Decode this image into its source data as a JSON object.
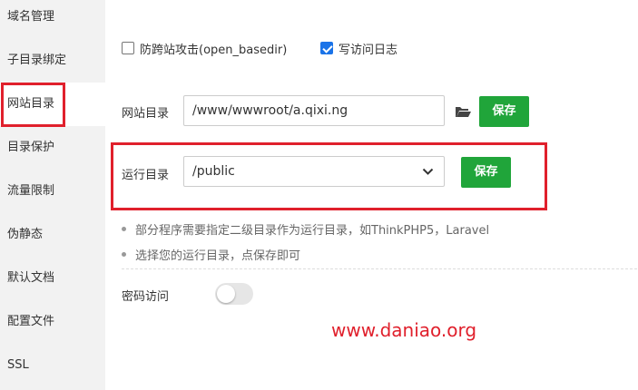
{
  "sidebar": {
    "items": [
      {
        "label": "域名管理"
      },
      {
        "label": "子目录绑定"
      },
      {
        "label": "网站目录"
      },
      {
        "label": "目录保护"
      },
      {
        "label": "流量限制"
      },
      {
        "label": "伪静态"
      },
      {
        "label": "默认文档"
      },
      {
        "label": "配置文件"
      },
      {
        "label": "SSL"
      }
    ]
  },
  "options": {
    "open_basedir_label": "防跨站攻击(open_basedir)",
    "open_basedir_checked": false,
    "access_log_label": "写访问日志",
    "access_log_checked": true
  },
  "site_dir": {
    "label": "网站目录",
    "value": "/www/wwwroot/a.qixi.ng",
    "save_label": "保存",
    "folder_icon": "folder-open-icon"
  },
  "run_dir": {
    "label": "运行目录",
    "selected": "/public",
    "save_label": "保存"
  },
  "notes": [
    "部分程序需要指定二级目录作为运行目录，如ThinkPHP5，Laravel",
    "选择您的运行目录，点保存即可"
  ],
  "password_access": {
    "label": "密码访问",
    "enabled": false
  },
  "watermark": "www.daniao.org",
  "colors": {
    "accent_green": "#20a53a",
    "highlight_red": "#e0202c",
    "checkbox_blue": "#1a73e8"
  }
}
